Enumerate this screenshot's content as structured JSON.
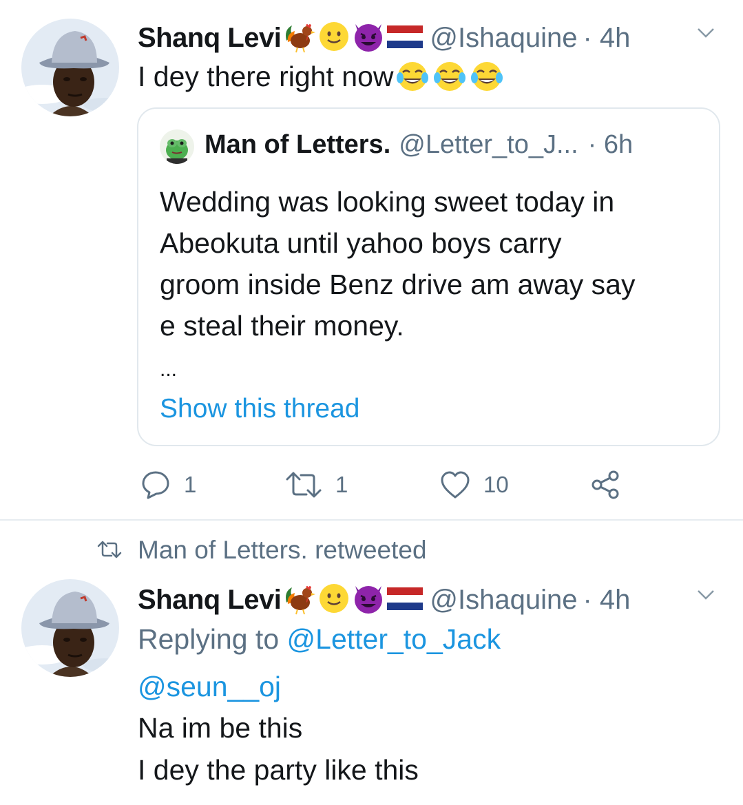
{
  "tweet1": {
    "author_name": "Shanq Levi",
    "author_emojis": [
      "rooster-emoji",
      "slightly-smiling-face-emoji",
      "smiling-devil-emoji",
      "netherlands-flag-emoji"
    ],
    "handle": "@Ishaquine",
    "time": "· 4h",
    "text": "I dey there right now",
    "text_emojis": [
      "tears-of-joy-emoji",
      "tears-of-joy-emoji",
      "tears-of-joy-emoji"
    ],
    "quoted": {
      "author_name": "Man of Letters.",
      "handle": "@Letter_to_J...",
      "time": "· 6h",
      "lines": [
        "Wedding was looking sweet today in",
        "Abeokuta until yahoo boys carry",
        "groom inside Benz drive am away say",
        "e steal their money."
      ],
      "ellipsis": "...",
      "show_thread": "Show this thread"
    },
    "actions": {
      "reply_count": "1",
      "retweet_count": "1",
      "like_count": "10"
    }
  },
  "tweet2": {
    "retweet_context": "Man of Letters. retweeted",
    "author_name": "Shanq Levi",
    "handle": "@Ishaquine",
    "time": "· 4h",
    "replying_prefix": "Replying to ",
    "replying_to": "@Letter_to_Jack",
    "mention": "@seun__oj",
    "line1": "Na im be this",
    "line2": "I dey the party like this"
  },
  "colors": {
    "link": "#1b95e0",
    "secondary_text": "#5b7083",
    "border": "#e1e8ed"
  }
}
